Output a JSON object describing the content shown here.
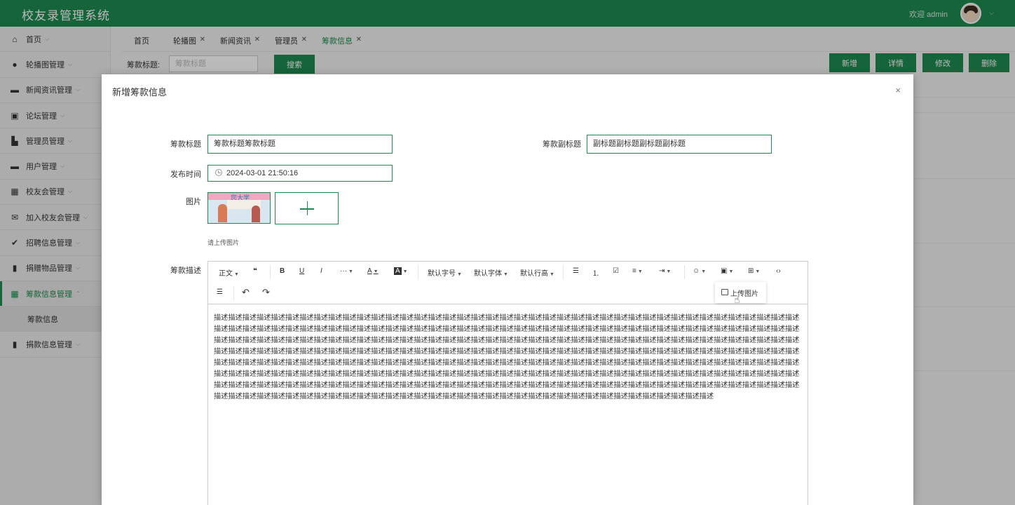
{
  "header": {
    "title": "校友录管理系统",
    "welcome": "欢迎 admin"
  },
  "sidebar": {
    "items": [
      {
        "label": "首页",
        "icon": "home-icon"
      },
      {
        "label": "轮播图管理",
        "icon": "circle-icon"
      },
      {
        "label": "新闻资讯管理",
        "icon": "window-icon"
      },
      {
        "label": "论坛管理",
        "icon": "briefcase-icon"
      },
      {
        "label": "管理员管理",
        "icon": "building-icon"
      },
      {
        "label": "用户管理",
        "icon": "card-icon"
      },
      {
        "label": "校友会管理",
        "icon": "table-icon"
      },
      {
        "label": "加入校友会管理",
        "icon": "mail-icon"
      },
      {
        "label": "招聘信息管理",
        "icon": "check-circle-icon"
      },
      {
        "label": "捐赠物品管理",
        "icon": "book-icon"
      },
      {
        "label": "筹款信息管理",
        "icon": "table-icon"
      },
      {
        "label": "捐款信息管理",
        "icon": "book-icon"
      }
    ],
    "active_sub": "筹款信息"
  },
  "tabs": [
    {
      "label": "首页"
    },
    {
      "label": "轮播图"
    },
    {
      "label": "新闻资讯"
    },
    {
      "label": "管理员"
    },
    {
      "label": "筹款信息"
    }
  ],
  "search": {
    "label": "筹款标题:",
    "placeholder": "筹款标题",
    "button": "搜索"
  },
  "actions": {
    "add": "新增",
    "detail": "详情",
    "edit": "修改",
    "delete": "删除"
  },
  "modal": {
    "title": "新增筹款信息",
    "close": "×",
    "fields": {
      "title_label": "筹款标题",
      "title_value": "筹款标题筹款标题",
      "subtitle_label": "筹款副标题",
      "subtitle_value": "副标题副标题副标题副标题",
      "time_label": "发布时间",
      "time_value": "2024-03-01 21:50:16",
      "image_label": "图片",
      "image_hint": "请上传图片",
      "image_banner_text": "您大学",
      "desc_label": "筹款描述"
    },
    "editor": {
      "toolbar": {
        "heading": "正文",
        "quote": "❝",
        "bold": "B",
        "underline": "U",
        "italic": "I",
        "more": "···",
        "font_color": "A",
        "bg_color": "A",
        "font_size": "默认字号",
        "font_family": "默认字体",
        "line_height": "默认行高",
        "bullet_list": "☰",
        "numbered_list": "⒈",
        "todo": "☑",
        "align": "≡",
        "indent": "⇥",
        "emoji": "☺",
        "image": "▣",
        "table": "⊞",
        "code": "‹›",
        "divider": "☰",
        "undo": "↶",
        "redo": "↷"
      },
      "content": "描述描述描述描述描述描述描述描述描述描述描述描述描述描述描述描述描述描述描述描述描述描述描述描述描述描述描述描述描述描述描述描述描述描述描述描述描述描述描述描述描述描述描述描述描述描述描述描述描述描述描述描述描述描述描述描述描述描述描述描述描述描述描述描述描述描述描述描述描述描述描述描述描述描述描述描述描述描述描述描述描述描述描述描述描述描述描述描述描述描述描述描述描述描述描述描述描述描述描述描述描述描述描述描述描述描述描述描述描述描述描述描述描述描述描述描述描述描述描述描述描述描述描述描述描述描述描述描述描述描述描述描述描述描述描述描述描述描述描述描述描述描述描述描述描述描述描述描述描述描述描述描述描述描述描述描述描述描述描述描述描述描述描述描述描述描述描述描述描述描述描述描述描述描述描述描述描述描述描述描述描述描述描述描述描述描述描述描述描述描述描述描述描述描述描述描述描述描述描述描述描述描述描述描述描述描述描述描述描述描述描述描述描述描述描述描述描述描述描述描述描述描述描述描述描述描述描述描述描述描述描述描述描述描述描述描述描述描述描述描述描述描述描述描述描述描述描述描述描述描述描述描述描述描述描述描述描述描述描述描述描述描述描述描述描述描述描述描述描述描述描述描述描述描述描述描述描述描述描述描述描述描述描述描述描述描述描述描述描述描述描述描述描述描述描述描述描述描述描述描述描述描述描述描述描述描述描述描述描述描述描述描述描述描述描述描述描述描述描述描述描述描述",
      "popup": "上传图片"
    }
  },
  "colors": {
    "primary": "#1e8a50",
    "header_bg": "#1e8a50"
  }
}
